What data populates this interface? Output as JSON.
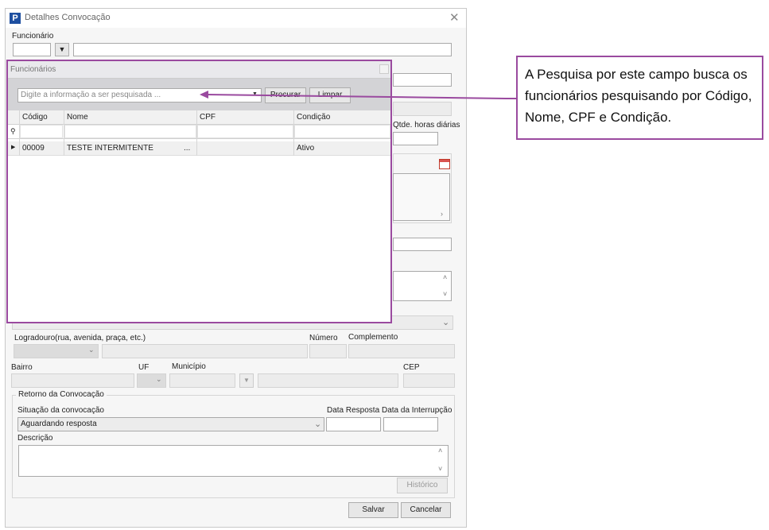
{
  "window": {
    "title": "Detalhes Convocação",
    "close_glyph": "✕"
  },
  "form": {
    "funcionario_label": "Funcionário",
    "qtde_horas_label": "Qtde. horas diárias",
    "logradouro_label": "Logradouro(rua, avenida, praça, etc.)",
    "numero_label": "Número",
    "complemento_label": "Complemento",
    "bairro_label": "Bairro",
    "uf_label": "UF",
    "municipio_label": "Município",
    "cep_label": "CEP",
    "retorno_label": "Retorno da Convocação",
    "situacao_label": "Situação da convocação",
    "situacao_value": "Aguardando resposta",
    "data_resposta_label": "Data Resposta",
    "data_interrupcao_label": "Data da Interrupção",
    "descricao_label": "Descrição",
    "historico_button": "Histórico",
    "salvar_button": "Salvar",
    "cancelar_button": "Cancelar"
  },
  "lookup": {
    "title": "Funcionários",
    "search_placeholder": "Digite a informação a ser pesquisada ...",
    "procurar_button": "Procurar",
    "limpar_button": "Limpar",
    "columns": [
      "Código",
      "Nome",
      "CPF",
      "Condição"
    ],
    "rows": [
      {
        "codigo": "00009",
        "nome": "TESTE INTERMITENTE",
        "ellipsis": "...",
        "cpf": "",
        "condicao": "Ativo"
      }
    ]
  },
  "annotation": {
    "text": "A Pesquisa por este campo busca os funcionários pesquisando por Código, Nome, CPF e Condição."
  },
  "colors": {
    "accent_purple": "#9a4a9f",
    "logo_blue": "#1e4fa0"
  },
  "icons": [
    "app-logo-icon",
    "close-icon",
    "dropdown-arrow-icon",
    "calendar-icon",
    "filter-pin-icon",
    "row-indicator-icon",
    "scroll-up-icon",
    "scroll-down-icon",
    "chevron-down-icon"
  ]
}
